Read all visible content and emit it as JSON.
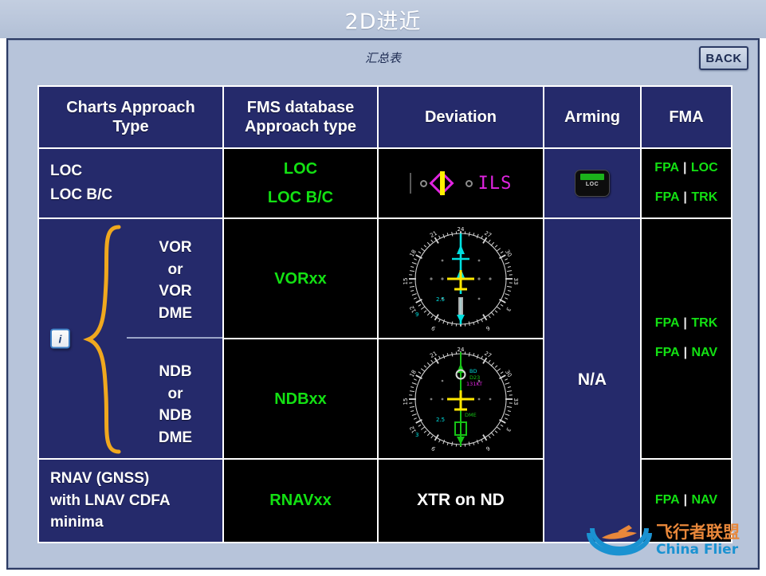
{
  "slide": {
    "title": "2D进近",
    "sub_title": "汇总表",
    "back_label": "BACK"
  },
  "table": {
    "headers": [
      "Charts Approach Type",
      "FMS database Approach type",
      "Deviation",
      "Arming",
      "FMA"
    ],
    "headers_lines": {
      "charts": [
        "Charts Approach",
        "Type"
      ],
      "fms": [
        "FMS database",
        "Approach type"
      ],
      "deviation": "Deviation",
      "arming": "Arming",
      "fma": "FMA"
    },
    "rows": [
      {
        "charts_lines": [
          "LOC",
          "LOC B/C"
        ],
        "fms_lines": [
          "LOC",
          "LOC B/C"
        ],
        "deviation_type": "ils-scale",
        "deviation_label": "ILS",
        "arming_type": "loc-button",
        "arming_label": "LOC",
        "fma_lines": [
          {
            "left": "FPA",
            "sep": "|",
            "right": "LOC"
          },
          {
            "left": "FPA",
            "sep": "|",
            "right": "TRK"
          }
        ]
      },
      {
        "charts_lines": [
          "VOR",
          "or",
          "VOR",
          "DME"
        ],
        "fms_lines": [
          "VORxx"
        ],
        "deviation_type": "nd-rose-vor",
        "arming_type": "na",
        "arming_label": "N/A",
        "fma_lines": [
          {
            "left": "FPA",
            "sep": "|",
            "right": "TRK"
          }
        ]
      },
      {
        "charts_lines": [
          "NDB",
          "or",
          "NDB",
          "DME"
        ],
        "fms_lines": [
          "NDBxx"
        ],
        "deviation_type": "nd-rose-ndb",
        "arming_type": "na",
        "fma_lines": [
          {
            "left": "FPA",
            "sep": "|",
            "right": "NAV"
          }
        ]
      },
      {
        "charts_lines": [
          "RNAV (GNSS)",
          "with LNAV CDFA",
          "minima"
        ],
        "fms_lines": [
          "RNAVxx"
        ],
        "deviation_type": "text",
        "deviation_label": "XTR on ND",
        "arming_type": "blank",
        "fma_lines": [
          {
            "left": "FPA",
            "sep": "|",
            "right": "NAV"
          }
        ]
      }
    ],
    "info_button_label": "i"
  },
  "nd_rose": {
    "vor": {
      "tick_labels": [
        "24",
        "21",
        "18",
        "15",
        "12",
        "9",
        "6",
        "3",
        "27",
        "30",
        "33"
      ],
      "range_label": "2.5",
      "left_label": "9"
    },
    "ndb": {
      "tick_labels": [
        "24",
        "21",
        "18",
        "15",
        "12",
        "9",
        "6",
        "3",
        "27",
        "30",
        "33"
      ],
      "range_label": "2.5",
      "waypoint_label": "DME",
      "ident_label": "BD",
      "dist_label": "D23",
      "mag_label": "131KT",
      "left_label": "3"
    }
  },
  "watermark": {
    "text_cn": "飞行者联盟",
    "text_en": "China Flier"
  },
  "colors": {
    "navy": "#252a6b",
    "panel_bg": "#b7c4da",
    "green": "#13e113",
    "magenta": "#e024e0",
    "yellow": "#fff000",
    "cyan": "#00e5e5",
    "brace_orange": "#f0a81e"
  }
}
